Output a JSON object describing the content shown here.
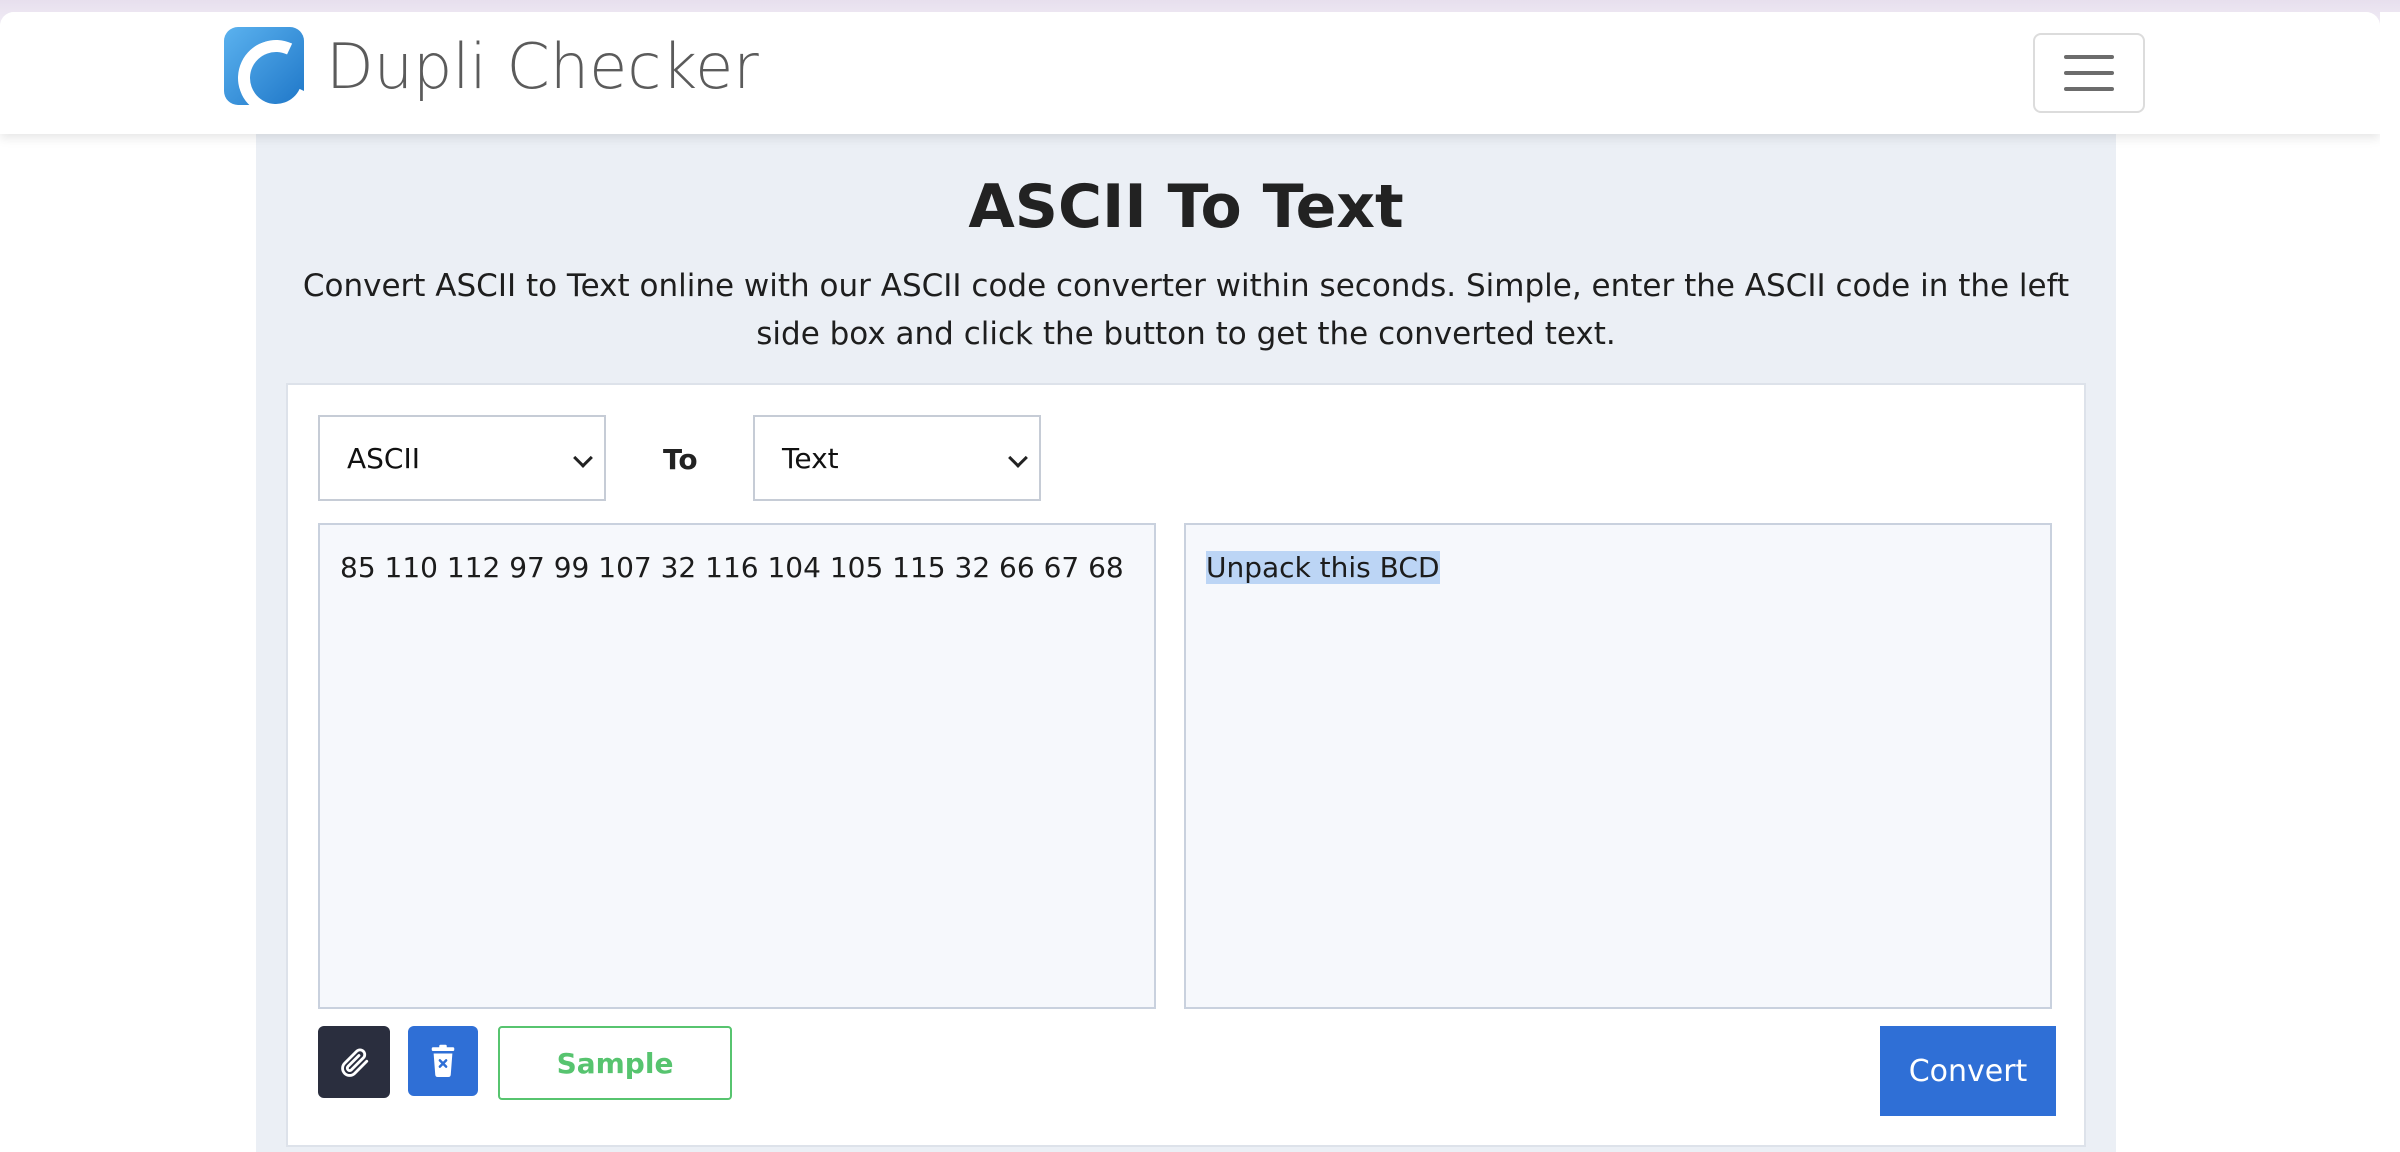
{
  "header": {
    "logo_text": "Dupli Checker"
  },
  "page": {
    "title": "ASCII To Text",
    "description": "Convert ASCII to Text online with our ASCII code converter within seconds. Simple, enter the ASCII code in the left side box and click the button to get the converted text."
  },
  "converter": {
    "from_select": "ASCII",
    "to_label": "To",
    "to_select": "Text",
    "input_value": "85 110 112 97 99 107 32 116 104 105 115 32 66 67 68",
    "output_value": "Unpack this BCD",
    "sample_label": "Sample",
    "convert_label": "Convert"
  },
  "colors": {
    "primary": "#2f6fd6",
    "sample_green": "#57c46f",
    "attach_dark": "#2a2e3e",
    "panel_bg": "#ebeff5"
  },
  "icons": {
    "attach": "paperclip-icon",
    "clear": "trash-icon",
    "menu": "hamburger-icon"
  }
}
